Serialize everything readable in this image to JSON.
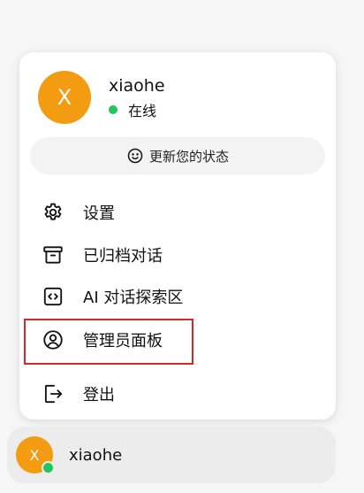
{
  "profile": {
    "avatar_letter": "X",
    "name": "xiaohe",
    "status": "在线"
  },
  "status_button": {
    "label": "更新您的状态",
    "icon": "smile-icon"
  },
  "menu": {
    "items": [
      {
        "label": "设置",
        "icon": "gear-icon"
      },
      {
        "label": "已归档对话",
        "icon": "archive-icon"
      },
      {
        "label": "AI 对话探索区",
        "icon": "code-icon"
      },
      {
        "label": "管理员面板",
        "icon": "user-circle-icon"
      },
      {
        "label": "登出",
        "icon": "logout-icon"
      }
    ]
  },
  "bottom_bar": {
    "avatar_letter": "X",
    "name": "xiaohe"
  },
  "colors": {
    "avatar": "#f39c12",
    "online": "#22c55e",
    "highlight": "#d62828"
  }
}
